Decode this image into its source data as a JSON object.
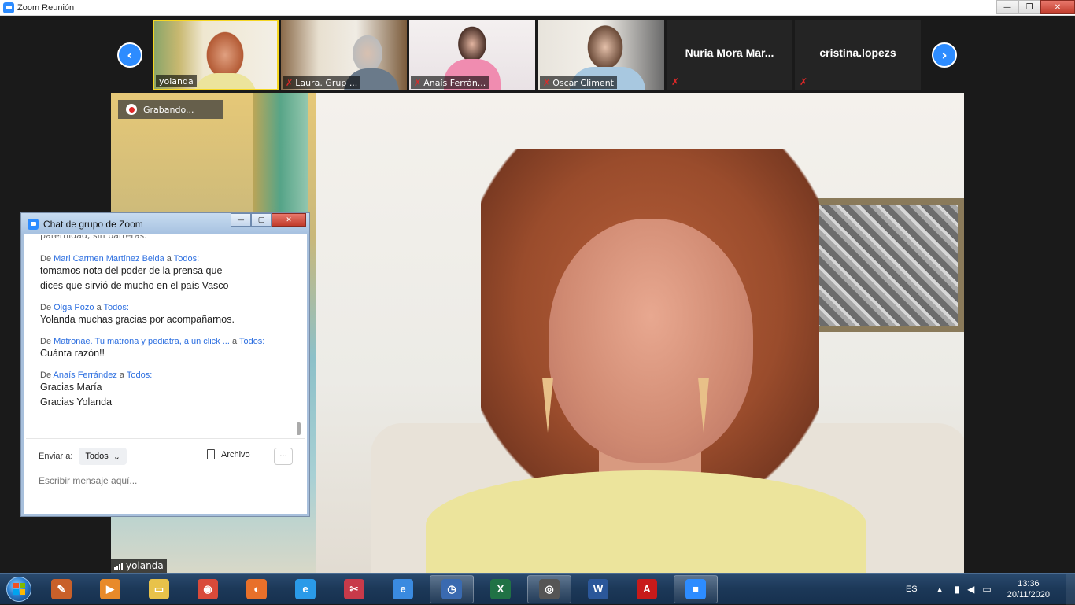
{
  "window": {
    "title": "Zoom Reunión",
    "minimize": "—",
    "maximize": "❐",
    "close": "✕"
  },
  "thumbnails": [
    {
      "name": "yolanda",
      "muted": false,
      "active": true
    },
    {
      "name": "Laura. Grup ...",
      "muted": true,
      "active": false
    },
    {
      "name": "Anaís Ferrán...",
      "muted": true,
      "active": false
    },
    {
      "name": "Oscar Climent",
      "muted": true,
      "active": false
    },
    {
      "name": "Nuria Mora Mar...",
      "muted": true,
      "active": false,
      "noVideo": true
    },
    {
      "name": "cristina.lopezs",
      "muted": true,
      "active": false,
      "noVideo": true
    }
  ],
  "nav": {
    "prev": "‹",
    "next": "›"
  },
  "recording": {
    "label": "Grabando..."
  },
  "speaker": {
    "name": "yolanda"
  },
  "chat": {
    "title": "Chat de grupo de Zoom",
    "winbtns": {
      "minimize": "—",
      "maximize": "▢",
      "close": "✕"
    },
    "cutoff_line": "paternidad, sin barreras.",
    "messages": [
      {
        "prefix": "De",
        "from": "Mari Carmen Martínez Belda",
        "to_prefix": "a",
        "to": "Todos:",
        "lines": [
          "tomamos nota del poder de la prensa que",
          "dices que sirvió de mucho en el país Vasco"
        ]
      },
      {
        "prefix": "De",
        "from": "Olga Pozo",
        "to_prefix": "a",
        "to": "Todos:",
        "lines": [
          "Yolanda muchas gracias por acompañarnos."
        ]
      },
      {
        "prefix": "De",
        "from": "Matronae. Tu matrona y pediatra, a un click ...",
        "to_prefix": "a",
        "to": "Todos:",
        "lines": [
          "Cuánta razón!!"
        ]
      },
      {
        "prefix": "De",
        "from": "Anaís Ferrández",
        "to_prefix": "a",
        "to": "Todos:",
        "lines": [
          "Gracias María",
          "Gracias Yolanda"
        ]
      }
    ],
    "send_to_label": "Enviar a:",
    "send_to_value": "Todos",
    "dropdown_chevron": "⌄",
    "file_label": "Archivo",
    "more_label": "···",
    "input_placeholder": "Escribir mensaje aquí..."
  },
  "taskbar": {
    "apps": [
      {
        "id": "pencil",
        "glyph": "✎",
        "color": "#c8602a",
        "running": false
      },
      {
        "id": "media",
        "glyph": "▶",
        "color": "#e88a2a",
        "running": false
      },
      {
        "id": "explorer",
        "glyph": "▭",
        "color": "#e8c24a",
        "running": false
      },
      {
        "id": "chrome",
        "glyph": "◉",
        "color": "#d94a3a",
        "running": false
      },
      {
        "id": "firefox",
        "glyph": "◐",
        "color": "#e8702a",
        "running": false
      },
      {
        "id": "edge",
        "glyph": "e",
        "color": "#2a9ae8",
        "running": false
      },
      {
        "id": "snipping",
        "glyph": "✂",
        "color": "#c83a4a",
        "running": false
      },
      {
        "id": "ie",
        "glyph": "e",
        "color": "#3a8ae0",
        "running": false
      },
      {
        "id": "timemachine",
        "glyph": "◷",
        "color": "#3a6ab0",
        "running": true
      },
      {
        "id": "excel",
        "glyph": "X",
        "color": "#207245",
        "running": false
      },
      {
        "id": "camera",
        "glyph": "◎",
        "color": "#555555",
        "running": true
      },
      {
        "id": "word",
        "glyph": "W",
        "color": "#2b579a",
        "running": false
      },
      {
        "id": "acrobat",
        "glyph": "A",
        "color": "#c81a1a",
        "running": false
      },
      {
        "id": "zoom",
        "glyph": "■",
        "color": "#2d8cff",
        "running": true
      }
    ],
    "tray": {
      "language": "ES",
      "expand": "▲",
      "time": "13:36",
      "date": "20/11/2020"
    }
  }
}
